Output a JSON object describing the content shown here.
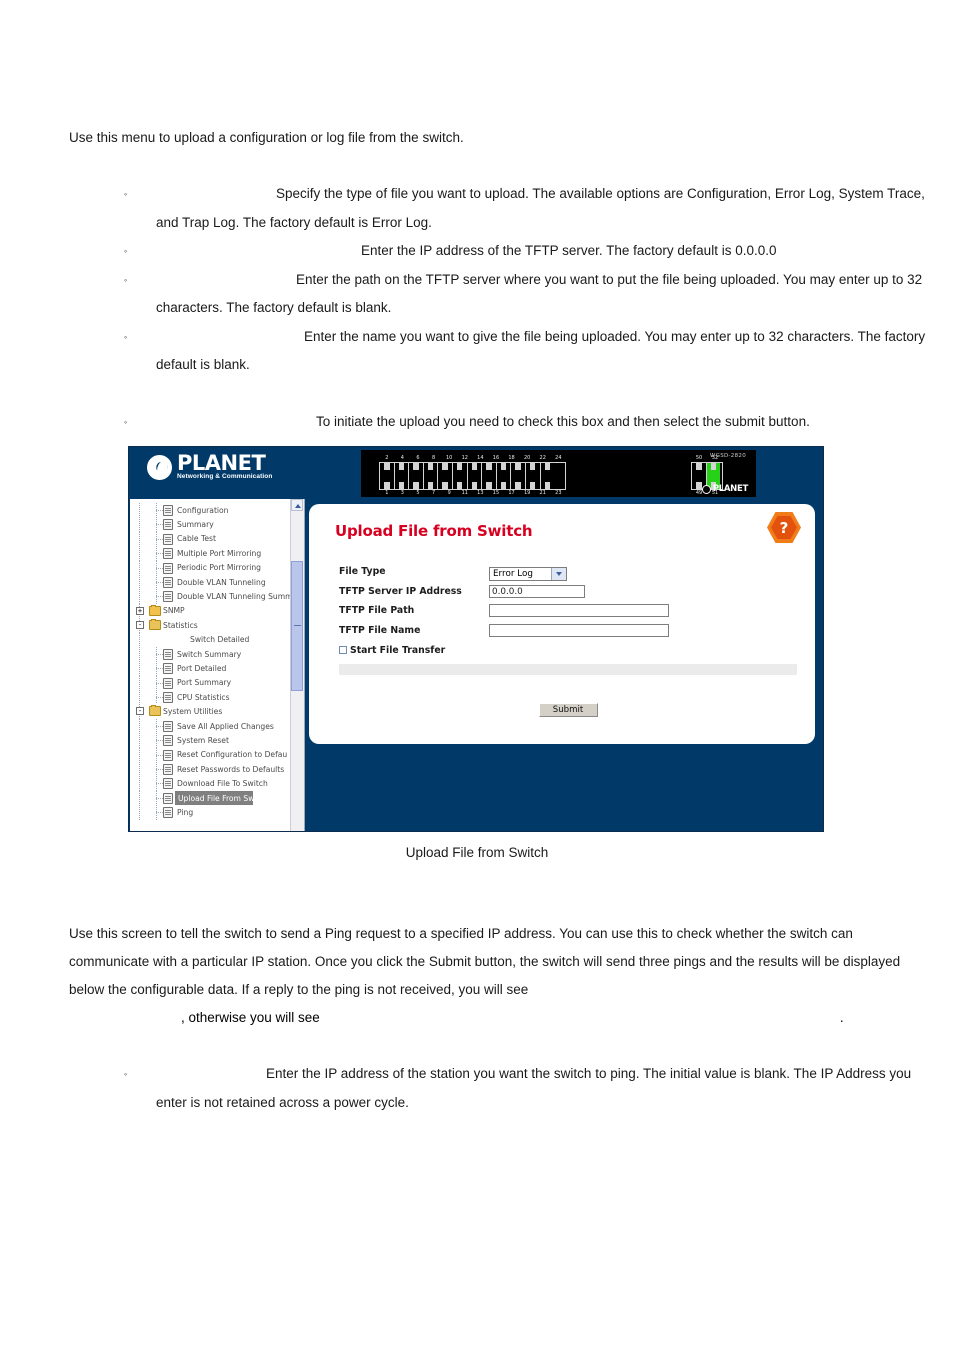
{
  "document": {
    "intro": "Use this menu to upload a configuration or log file from the switch.",
    "bullets": [
      "Specify the type of file you want to upload. The available options are Configuration, Error Log, System Trace, and Trap Log. The factory default is Error Log.",
      "Enter the IP address of the TFTP server. The factory default is 0.0.0.0",
      "Enter the path on the TFTP server where you want to put the file being uploaded. You may enter up to 32 characters. The factory default is blank.",
      "Enter the name you want to give the file being uploaded. You may enter up to 32 characters. The factory default is blank.",
      "To initiate the upload you need to check this box and then select the submit button."
    ],
    "figure_caption": "Upload File from Switch",
    "ping_paragraph": "Use this screen to tell the switch to send a Ping request to a specified IP address. You can use this to check whether the switch can communicate with a particular IP station. Once you click the Submit button, the switch will send three pings and the results will be displayed below the configurable data. If a reply to the ping is not received, you will see",
    "ping_line2_mid": ", otherwise you will see",
    "ping_line2_end": ".",
    "ping_bullet": "Enter the IP address of the station you want the switch to ping. The initial value is blank. The IP Address you enter is not retained across a power cycle.",
    "bullet_marker": "◦"
  },
  "screenshot": {
    "banner": {
      "brand_name": "PLANET",
      "brand_tagline": "Networking & Communication",
      "device_model": "WGSD-2820",
      "device_brand": "PLANET",
      "ports_top": [
        "2",
        "4",
        "6",
        "8",
        "10",
        "12",
        "14",
        "16",
        "18",
        "20",
        "22",
        "24"
      ],
      "ports_bottom": [
        "1",
        "3",
        "5",
        "7",
        "9",
        "11",
        "13",
        "15",
        "17",
        "19",
        "21",
        "23"
      ],
      "uplink_top": [
        "50",
        "52"
      ],
      "uplink_bottom": [
        "49",
        "51"
      ]
    },
    "tree": {
      "items": [
        {
          "label": "Configuration",
          "level": 2,
          "icon": "page-icon",
          "selected": false
        },
        {
          "label": "Summary",
          "level": 2,
          "icon": "page-icon",
          "selected": false
        },
        {
          "label": "Cable Test",
          "level": 2,
          "icon": "page-icon",
          "selected": false
        },
        {
          "label": "Multiple Port Mirroring",
          "level": 2,
          "icon": "page-icon",
          "selected": false
        },
        {
          "label": "Periodic Port Mirroring",
          "level": 2,
          "icon": "page-icon",
          "selected": false
        },
        {
          "label": "Double VLAN Tunneling",
          "level": 2,
          "icon": "page-icon",
          "selected": false
        },
        {
          "label": "Double VLAN Tunneling Summ",
          "level": 2,
          "icon": "page-icon",
          "selected": false
        },
        {
          "label": "SNMP",
          "level": 1,
          "icon": "folder-closed-icon",
          "expander": "+",
          "selected": false
        },
        {
          "label": "Statistics",
          "level": 1,
          "icon": "folder-open-icon",
          "expander": "-",
          "selected": false
        },
        {
          "label": "Switch Detailed",
          "level": 3,
          "icon": "none",
          "selected": false
        },
        {
          "label": "Switch Summary",
          "level": 2,
          "icon": "page-icon",
          "selected": false
        },
        {
          "label": "Port Detailed",
          "level": 2,
          "icon": "page-icon",
          "selected": false
        },
        {
          "label": "Port Summary",
          "level": 2,
          "icon": "page-icon",
          "selected": false
        },
        {
          "label": "CPU Statistics",
          "level": 2,
          "icon": "page-icon",
          "selected": false
        },
        {
          "label": "System Utilities",
          "level": 1,
          "icon": "folder-open-icon",
          "expander": "-",
          "selected": false
        },
        {
          "label": "Save All Applied Changes",
          "level": 2,
          "icon": "page-icon",
          "selected": false
        },
        {
          "label": "System Reset",
          "level": 2,
          "icon": "page-icon",
          "selected": false
        },
        {
          "label": "Reset Configuration to Defau",
          "level": 2,
          "icon": "page-icon",
          "selected": false
        },
        {
          "label": "Reset Passwords to Defaults",
          "level": 2,
          "icon": "page-icon",
          "selected": false
        },
        {
          "label": "Download File To Switch",
          "level": 2,
          "icon": "page-icon",
          "selected": false
        },
        {
          "label": "Upload File From Switch",
          "level": 2,
          "icon": "page-icon",
          "selected": true
        },
        {
          "label": "Ping",
          "level": 2,
          "icon": "page-icon",
          "selected": false
        }
      ]
    },
    "panel": {
      "title": "Upload File from Switch",
      "help_glyph": "?",
      "fields": {
        "file_type_label": "File Type",
        "file_type_value": "Error Log",
        "file_type_options": [
          "Configuration",
          "Error Log",
          "System Trace",
          "Trap Log"
        ],
        "tftp_ip_label": "TFTP Server IP Address",
        "tftp_ip_value": "0.0.0.0",
        "tftp_path_label": "TFTP File Path",
        "tftp_path_value": "",
        "tftp_name_label": "TFTP File Name",
        "tftp_name_value": "",
        "start_transfer_label": "Start File Transfer",
        "start_transfer_checked": false
      },
      "submit_label": "Submit"
    },
    "colors": {
      "chrome_blue": "#013a69",
      "title_red": "#d80020",
      "help_orange": "#f07d1a",
      "led_green": "#27d117",
      "selection_grey": "#808080"
    }
  }
}
